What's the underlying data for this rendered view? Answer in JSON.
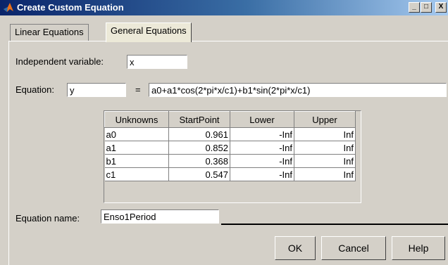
{
  "window": {
    "title": "Create Custom Equation",
    "minimize": "_",
    "maximize": "□",
    "close": "X"
  },
  "tabs": [
    {
      "label": "Linear Equations"
    },
    {
      "label": "General Equations"
    }
  ],
  "form": {
    "independent_label": "Independent variable:",
    "independent_value": "x",
    "equation_label": "Equation:",
    "equation_lhs": "y",
    "equals": "=",
    "equation_rhs": "a0+a1*cos(2*pi*x/c1)+b1*sin(2*pi*x/c1)",
    "name_label": "Equation name:",
    "name_value": "Enso1Period"
  },
  "table": {
    "headers": [
      "Unknowns",
      "StartPoint",
      "Lower",
      "Upper"
    ],
    "rows": [
      [
        "a0",
        "0.961",
        "-Inf",
        "Inf"
      ],
      [
        "a1",
        "0.852",
        "-Inf",
        "Inf"
      ],
      [
        "b1",
        "0.368",
        "-Inf",
        "Inf"
      ],
      [
        "c1",
        "0.547",
        "-Inf",
        "Inf"
      ]
    ]
  },
  "buttons": {
    "ok": "OK",
    "cancel": "Cancel",
    "help": "Help"
  }
}
